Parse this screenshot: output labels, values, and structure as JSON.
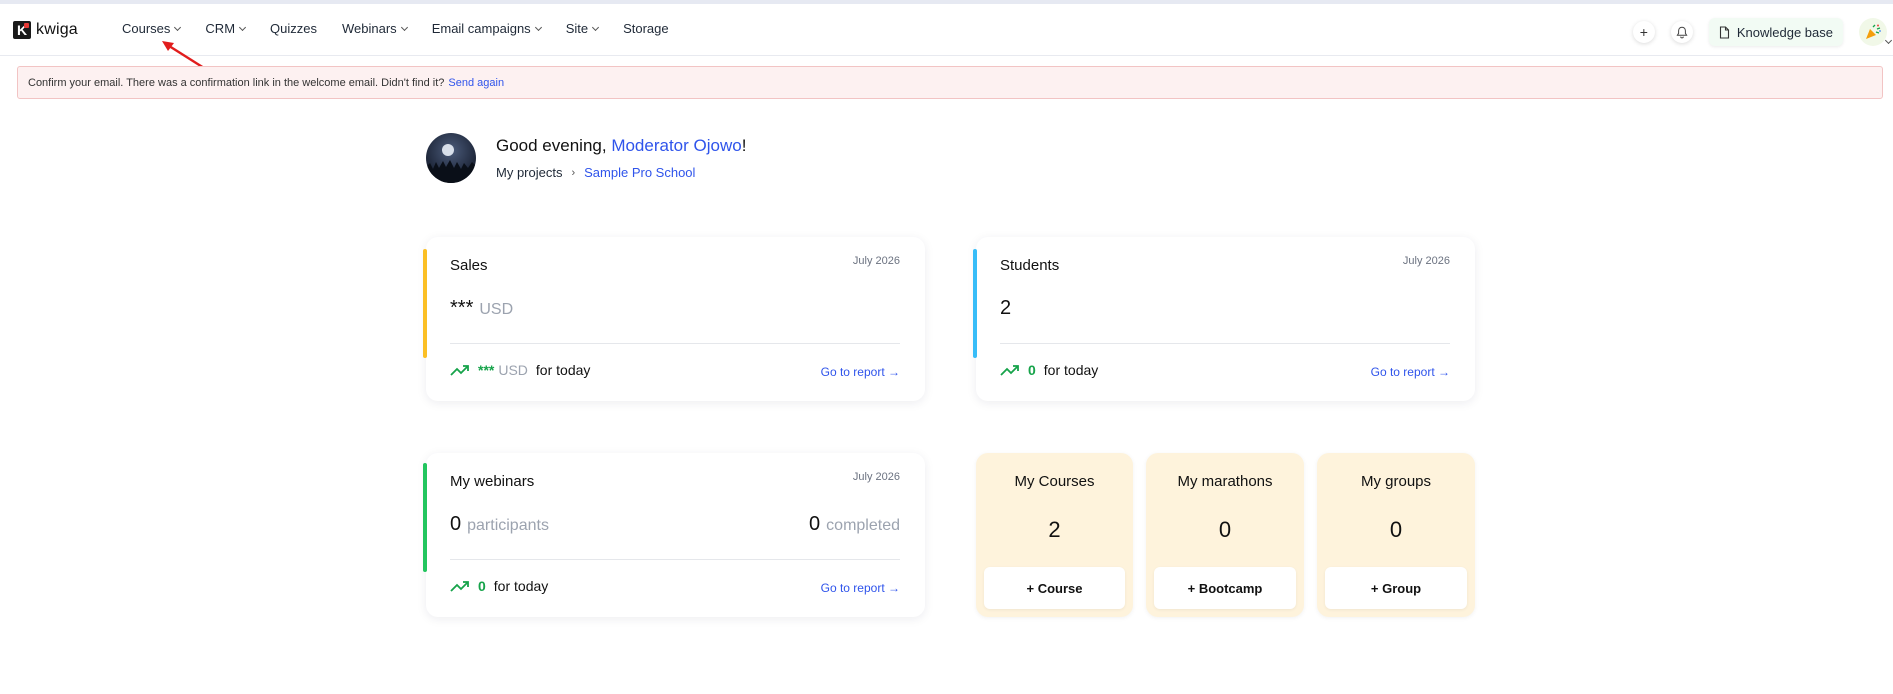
{
  "brand": {
    "name": "kwiga"
  },
  "nav": {
    "items": [
      {
        "label": "Courses",
        "dropdown": true
      },
      {
        "label": "CRM",
        "dropdown": true
      },
      {
        "label": "Quizzes",
        "dropdown": false
      },
      {
        "label": "Webinars",
        "dropdown": true
      },
      {
        "label": "Email campaigns",
        "dropdown": true
      },
      {
        "label": "Site",
        "dropdown": true
      },
      {
        "label": "Storage",
        "dropdown": false
      }
    ],
    "add_label": "+",
    "knowledge_base_label": "Knowledge base"
  },
  "alert": {
    "text": "Confirm your email. There was a confirmation link in the welcome email. Didn't find it?",
    "link": "Send again"
  },
  "hero": {
    "greeting": "Good evening, ",
    "name": "Moderator Ojowo",
    "exclaim": "!",
    "breadcrumb_root": "My projects",
    "breadcrumb_sep": "›",
    "breadcrumb_current": "Sample Pro School"
  },
  "sales": {
    "title": "Sales",
    "date": "July 2026",
    "value": "***",
    "currency": "USD",
    "today_value": "***",
    "today_currency": "USD",
    "today_label": "for today",
    "report_link": "Go to report →"
  },
  "students": {
    "title": "Students",
    "date": "July 2026",
    "value": "2",
    "today_value": "0",
    "today_label": "for today",
    "report_link": "Go to report →"
  },
  "webinars": {
    "title": "My webinars",
    "date": "July 2026",
    "participants_value": "0",
    "participants_label": "participants",
    "completed_value": "0",
    "completed_label": "completed",
    "today_value": "0",
    "today_label": "for today",
    "report_link": "Go to report →"
  },
  "tiles": [
    {
      "title": "My Courses",
      "count": "2",
      "button": "+ Course"
    },
    {
      "title": "My marathons",
      "count": "0",
      "button": "+ Bootcamp"
    },
    {
      "title": "My groups",
      "count": "0",
      "button": "+ Group"
    }
  ],
  "colors": {
    "accent_link": "#2f54eb",
    "sales_bar": "#fbbf24",
    "students_bar": "#38bdf8",
    "webinars_bar": "#22c55e",
    "trend_green": "#16a34a",
    "tile_bg": "#fef3dc",
    "alert_bg": "#fdf1f1",
    "annotation_arrow": "#e11d1d"
  }
}
